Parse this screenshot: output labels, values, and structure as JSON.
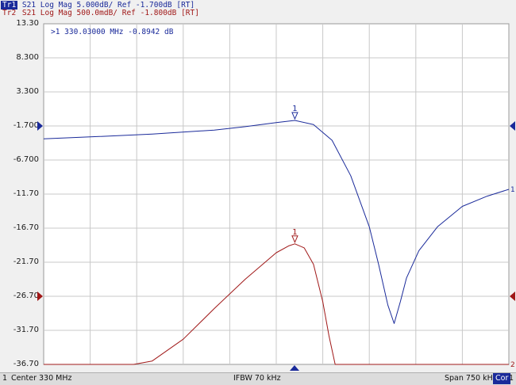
{
  "header": {
    "trace1": {
      "tag": "Tr1",
      "text": "S21 Log Mag 5.000dB/ Ref -1.700dB [RT]",
      "color": "#1a2a9a"
    },
    "trace2": {
      "tag": "Tr2",
      "text": "S21 Log Mag 500.0mdB/ Ref -1.800dB [RT]",
      "color": "#a01818"
    }
  },
  "marker_readout": ">1  330.03000 MHz -0.8942 dB",
  "status": {
    "channel": "1",
    "center": "Center 330 MHz",
    "ifbw": "IFBW 70 kHz",
    "span": "Span 750 kHz",
    "cor": "Cor",
    "tail": "1"
  },
  "chart_data": {
    "type": "line",
    "xlabel": "",
    "ylabel": "",
    "x_unit": "MHz",
    "xlim": [
      329.625,
      330.375
    ],
    "ylim": [
      -36.7,
      13.3
    ],
    "yticks": [
      "13.30",
      "8.300",
      "3.300",
      "-1.700",
      "-6.700",
      "-11.70",
      "-16.70",
      "-21.70",
      "-26.70",
      "-31.70",
      "-36.70"
    ],
    "grid": true,
    "series": [
      {
        "name": "Tr1",
        "color": "#1a2a9a",
        "x": [
          329.625,
          329.7,
          329.8,
          329.9,
          329.95,
          330.0,
          330.03,
          330.06,
          330.09,
          330.12,
          330.15,
          330.165,
          330.18,
          330.19,
          330.2,
          330.21,
          330.23,
          330.26,
          330.3,
          330.34,
          330.375
        ],
        "y": [
          -3.6,
          -3.3,
          -2.9,
          -2.3,
          -1.8,
          -1.2,
          -0.89,
          -1.5,
          -3.8,
          -9.0,
          -16.5,
          -22.0,
          -28.0,
          -30.7,
          -27.5,
          -24.0,
          -20.0,
          -16.5,
          -13.5,
          -12.0,
          -11.0
        ]
      },
      {
        "name": "Tr2",
        "color": "#a01818",
        "x": [
          329.625,
          329.7,
          329.77,
          329.8,
          329.85,
          329.9,
          329.95,
          330.0,
          330.02,
          330.03,
          330.045,
          330.06,
          330.075,
          330.085,
          330.095,
          330.375
        ],
        "y": [
          -36.7,
          -36.7,
          -36.7,
          -36.2,
          -33.0,
          -28.5,
          -24.2,
          -20.3,
          -19.3,
          -19.0,
          -19.6,
          -22.0,
          -27.5,
          -32.5,
          -36.7,
          -36.7
        ]
      }
    ],
    "markers": [
      {
        "trace": "Tr1",
        "label": "1",
        "x": 330.03,
        "y": -0.89
      },
      {
        "trace": "Tr2",
        "label": "1",
        "x": 330.03,
        "y": -19.0
      }
    ],
    "ref_markers": [
      {
        "trace": "Tr1",
        "label": "1",
        "color": "#1a2a9a",
        "y": -1.7
      },
      {
        "trace": "Tr2",
        "label": "2",
        "color": "#a01818",
        "y": -26.7
      }
    ],
    "right_labels": [
      {
        "label": "1",
        "color": "#1a2a9a",
        "y": -11.0
      },
      {
        "label": "2",
        "color": "#a01818",
        "y": -36.7
      }
    ]
  }
}
